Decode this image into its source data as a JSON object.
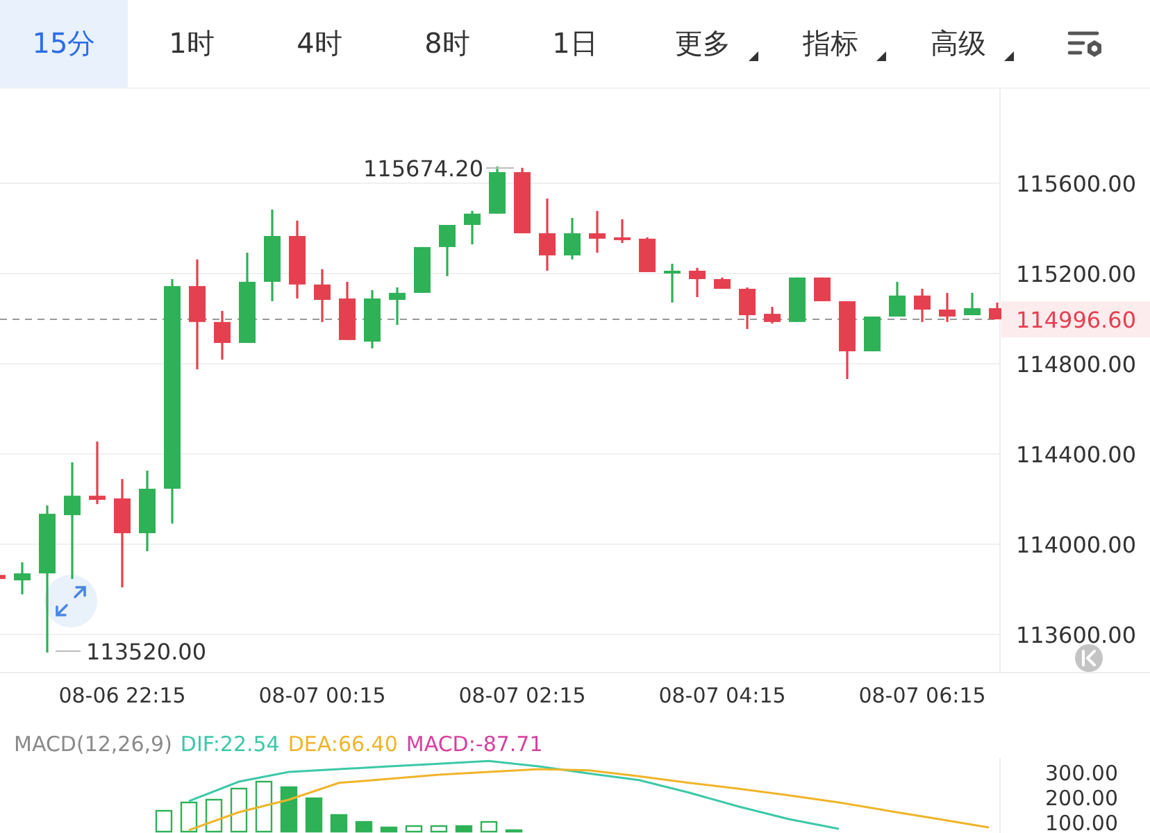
{
  "tabs": [
    {
      "label": "15分",
      "selected": true,
      "kind": "plain"
    },
    {
      "label": "1时",
      "selected": false,
      "kind": "plain"
    },
    {
      "label": "4时",
      "selected": false,
      "kind": "plain"
    },
    {
      "label": "8时",
      "selected": false,
      "kind": "plain"
    },
    {
      "label": "1日",
      "selected": false,
      "kind": "plain"
    },
    {
      "label": "更多",
      "selected": false,
      "kind": "dropdown"
    },
    {
      "label": "指标",
      "selected": false,
      "kind": "dropdown"
    },
    {
      "label": "高级",
      "selected": false,
      "kind": "dropdown"
    }
  ],
  "chart": {
    "current_price": "114996.60",
    "high_label": "115674.20",
    "low_label": "113520.00",
    "chart_data": {
      "type": "candlestick",
      "categories": [
        null,
        null,
        null,
        null,
        null,
        "08-06 22:15",
        null,
        null,
        null,
        null,
        null,
        null,
        null,
        "08-07 00:15",
        null,
        null,
        null,
        null,
        null,
        null,
        null,
        "08-07 02:15",
        null,
        null,
        null,
        null,
        null,
        null,
        null,
        "08-07 04:15",
        null,
        null,
        null,
        null,
        null,
        null,
        null,
        "08-07 06:15",
        null,
        null,
        null
      ],
      "ylim": [
        113428,
        116018
      ],
      "grid": true,
      "ref_lines": [
        {
          "axis": "y",
          "value": 114996.6
        }
      ],
      "yticks": [
        {
          "value": 115600,
          "label": "115600.00"
        },
        {
          "value": 115200,
          "label": "115200.00"
        },
        {
          "value": 114800,
          "label": "114800.00"
        },
        {
          "value": 114400,
          "label": "114400.00"
        },
        {
          "value": 114000,
          "label": "114000.00"
        },
        {
          "value": 113600,
          "label": "113600.00"
        }
      ],
      "ohlc": [
        [
          113864,
          113864,
          113846,
          113846
        ],
        [
          113840,
          113920,
          113778,
          113871
        ],
        [
          113871,
          114172,
          113520,
          114135
        ],
        [
          114129,
          114363,
          113846,
          114215
        ],
        [
          114215,
          114455,
          114178,
          114197
        ],
        [
          114203,
          114289,
          113809,
          114049
        ],
        [
          114049,
          114326,
          113969,
          114246
        ],
        [
          114246,
          115175,
          114092,
          115144
        ],
        [
          115144,
          115262,
          114775,
          114985
        ],
        [
          114985,
          115034,
          114818,
          114892
        ],
        [
          114892,
          115292,
          114892,
          115163
        ],
        [
          115163,
          115483,
          115077,
          115366
        ],
        [
          115366,
          115434,
          115089,
          115151
        ],
        [
          115151,
          115219,
          114985,
          115083
        ],
        [
          115089,
          115163,
          114905,
          114905
        ],
        [
          114898,
          115126,
          114868,
          115089
        ],
        [
          115083,
          115138,
          114972,
          115114
        ],
        [
          115114,
          115317,
          115114,
          115317
        ],
        [
          115317,
          115415,
          115188,
          115415
        ],
        [
          115415,
          115477,
          115329,
          115465
        ],
        [
          115465,
          115674.2,
          115465,
          115649
        ],
        [
          115649,
          115668,
          115378,
          115378
        ],
        [
          115378,
          115532,
          115212,
          115280
        ],
        [
          115280,
          115446,
          115262,
          115378
        ],
        [
          115378,
          115477,
          115292,
          115354
        ],
        [
          115360,
          115440,
          115335,
          115348
        ],
        [
          115354,
          115360,
          115206,
          115206
        ],
        [
          115206,
          115243,
          115071,
          115212
        ],
        [
          115212,
          115225,
          115095,
          115175
        ],
        [
          115175,
          115182,
          115132,
          115132
        ],
        [
          115132,
          115138,
          114954,
          115015
        ],
        [
          115021,
          115052,
          114978,
          114985
        ],
        [
          114985,
          115182,
          114985,
          115182
        ],
        [
          115182,
          115182,
          115077,
          115077
        ],
        [
          115077,
          115077,
          114732,
          114855
        ],
        [
          114855,
          115009,
          114855,
          115009
        ],
        [
          115009,
          115163,
          115009,
          115102
        ],
        [
          115102,
          115132,
          114985,
          115040
        ],
        [
          115040,
          115114,
          114985,
          115009
        ],
        [
          115015,
          115114,
          115015,
          115046
        ],
        [
          115046,
          115071,
          114996.6,
          114996.6
        ]
      ]
    }
  },
  "macd": {
    "legend": [
      {
        "text": "MACD(12,26,9)",
        "color": "#8a8a8a"
      },
      {
        "text": "DIF:22.54",
        "color": "#3cc8a8"
      },
      {
        "text": "DEA:66.40",
        "color": "#f0b429"
      },
      {
        "text": "MACD:-87.71",
        "color": "#d6409f"
      }
    ],
    "chart_data": {
      "type": "line",
      "ylim": [
        55.6,
        355.6
      ],
      "yticks": [
        {
          "value": 300,
          "label": "300.00"
        },
        {
          "value": 200,
          "label": "200.00"
        },
        {
          "value": 100,
          "label": "100.00"
        }
      ],
      "series": [
        {
          "color": "#3cc8a8",
          "values": [
            null,
            183,
            261,
            300,
            311,
            322,
            333,
            344,
            322,
            294,
            267,
            217,
            161,
            111,
            72,
            null,
            null,
            null
          ]
        },
        {
          "color": "#f0b429",
          "values": [
            null,
            67,
            139,
            189,
            256,
            272,
            289,
            300,
            311,
            306,
            283,
            256,
            233,
            206,
            178,
            144,
            111,
            78
          ]
        }
      ]
    }
  }
}
